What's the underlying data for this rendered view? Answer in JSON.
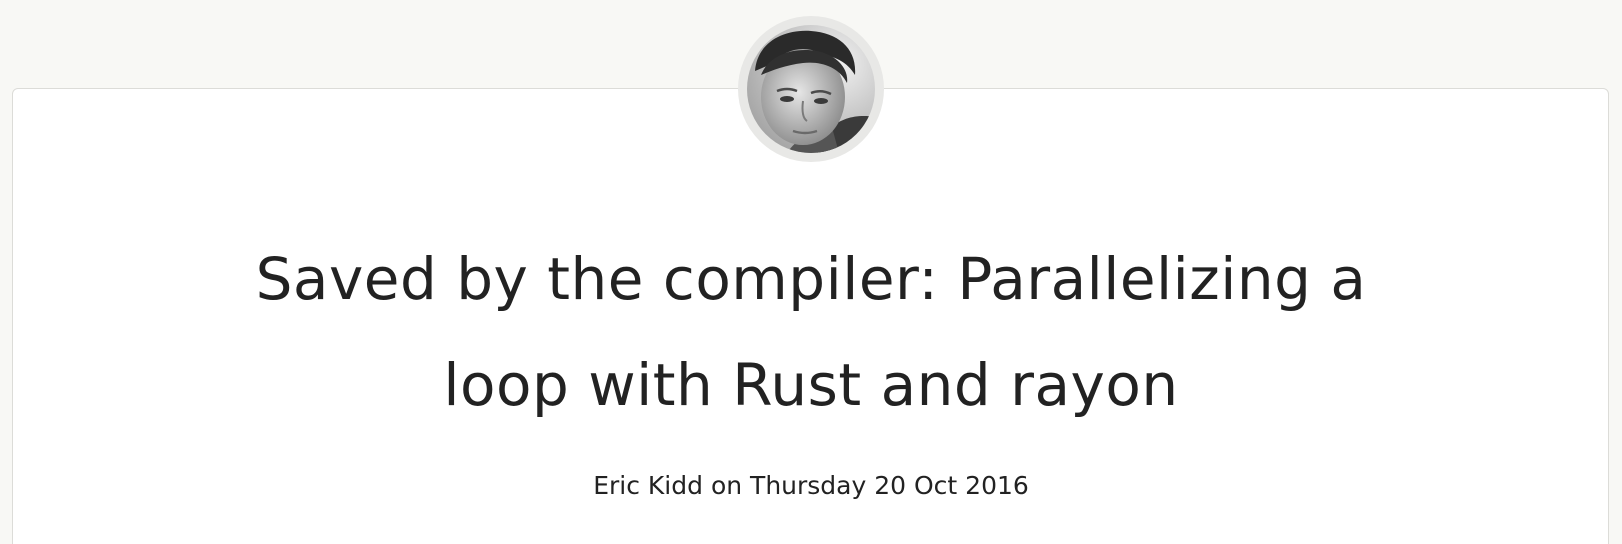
{
  "post": {
    "title": "Saved by the compiler: Parallelizing a loop with Rust and rayon",
    "author": "Eric Kidd",
    "byline_sep": " on ",
    "date": "Thursday 20 Oct 2016"
  },
  "avatar": {
    "icon": "author-portrait"
  },
  "colors": {
    "page_background": "#f8f8f5",
    "card_background": "#ffffff",
    "text": "#222222",
    "avatar_ring": "#e8e8e6"
  }
}
